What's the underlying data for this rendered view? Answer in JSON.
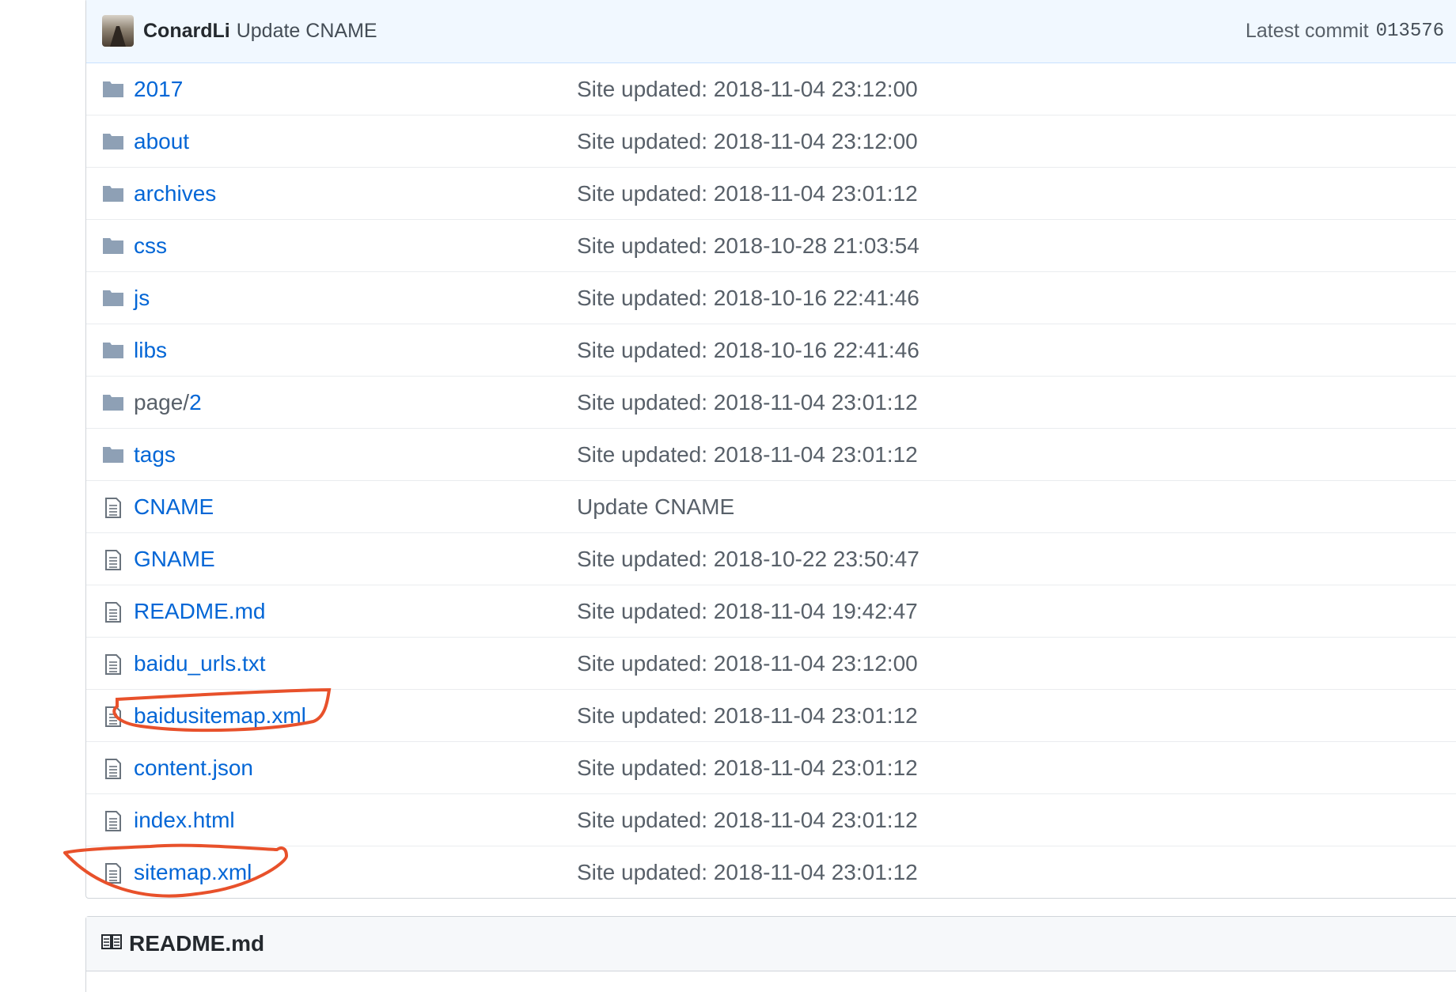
{
  "commit": {
    "author": "ConardLi",
    "message": "Update CNAME",
    "latest_label": "Latest commit",
    "sha": "013576"
  },
  "files": [
    {
      "type": "folder",
      "name": "2017",
      "message": "Site updated: 2018-11-04 23:12:00"
    },
    {
      "type": "folder",
      "name": "about",
      "message": "Site updated: 2018-11-04 23:12:00"
    },
    {
      "type": "folder",
      "name": "archives",
      "message": "Site updated: 2018-11-04 23:01:12"
    },
    {
      "type": "folder",
      "name": "css",
      "message": "Site updated: 2018-10-28 21:03:54"
    },
    {
      "type": "folder",
      "name": "js",
      "message": "Site updated: 2018-10-16 22:41:46"
    },
    {
      "type": "folder",
      "name": "libs",
      "message": "Site updated: 2018-10-16 22:41:46"
    },
    {
      "type": "folder",
      "name_prefix": "page/",
      "name": "2",
      "message": "Site updated: 2018-11-04 23:01:12"
    },
    {
      "type": "folder",
      "name": "tags",
      "message": "Site updated: 2018-11-04 23:01:12"
    },
    {
      "type": "file",
      "name": "CNAME",
      "message": "Update CNAME"
    },
    {
      "type": "file",
      "name": "GNAME",
      "message": "Site updated: 2018-10-22 23:50:47"
    },
    {
      "type": "file",
      "name": "README.md",
      "message": "Site updated: 2018-11-04 19:42:47"
    },
    {
      "type": "file",
      "name": "baidu_urls.txt",
      "message": "Site updated: 2018-11-04 23:12:00"
    },
    {
      "type": "file",
      "name": "baidusitemap.xml",
      "message": "Site updated: 2018-11-04 23:01:12"
    },
    {
      "type": "file",
      "name": "content.json",
      "message": "Site updated: 2018-11-04 23:01:12"
    },
    {
      "type": "file",
      "name": "index.html",
      "message": "Site updated: 2018-11-04 23:01:12"
    },
    {
      "type": "file",
      "name": "sitemap.xml",
      "message": "Site updated: 2018-11-04 23:01:12"
    }
  ],
  "readme": {
    "title": "README.md",
    "icon": "book-icon"
  },
  "colors": {
    "link": "#0366d6",
    "annotation": "#e8512b"
  }
}
